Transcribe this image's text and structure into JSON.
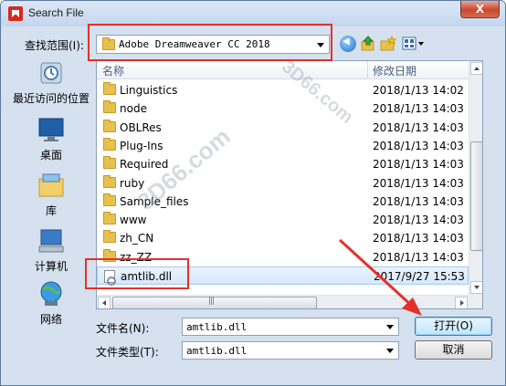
{
  "window": {
    "title": "Search File",
    "close_label": "X"
  },
  "look_in": {
    "label": "查找范围(I):",
    "value": "Adobe Dreamweaver CC 2018"
  },
  "places": [
    {
      "name": "recent",
      "label": "最近访问的位置"
    },
    {
      "name": "desktop",
      "label": "桌面"
    },
    {
      "name": "library",
      "label": "库"
    },
    {
      "name": "computer",
      "label": "计算机"
    },
    {
      "name": "network",
      "label": "网络"
    }
  ],
  "columns": {
    "name": "名称",
    "date": "修改日期"
  },
  "files": [
    {
      "name": "Linguistics",
      "date": "2018/1/13 14:02",
      "type": "folder"
    },
    {
      "name": "node",
      "date": "2018/1/13 14:03",
      "type": "folder"
    },
    {
      "name": "OBLRes",
      "date": "2018/1/13 14:03",
      "type": "folder"
    },
    {
      "name": "Plug-Ins",
      "date": "2018/1/13 14:03",
      "type": "folder"
    },
    {
      "name": "Required",
      "date": "2018/1/13 14:03",
      "type": "folder"
    },
    {
      "name": "ruby",
      "date": "2018/1/13 14:03",
      "type": "folder"
    },
    {
      "name": "Sample_files",
      "date": "2018/1/13 14:03",
      "type": "folder"
    },
    {
      "name": "www",
      "date": "2018/1/13 14:03",
      "type": "folder"
    },
    {
      "name": "zh_CN",
      "date": "2018/1/13 14:03",
      "type": "folder"
    },
    {
      "name": "zz_ZZ",
      "date": "2018/1/13 14:03",
      "type": "folder"
    },
    {
      "name": "amtlib.dll",
      "date": "2017/9/27 15:53",
      "type": "dll",
      "selected": true
    }
  ],
  "file_name": {
    "label": "文件名(N):",
    "value": "amtlib.dll"
  },
  "file_type": {
    "label": "文件类型(T):",
    "value": "amtlib.dll"
  },
  "buttons": {
    "open": "打开(O)",
    "cancel": "取消"
  },
  "watermark": "3D66.com",
  "colors": {
    "annotation_red": "#e4312b",
    "selection": "#d6e8fb",
    "chrome": "#d6e1ef"
  }
}
